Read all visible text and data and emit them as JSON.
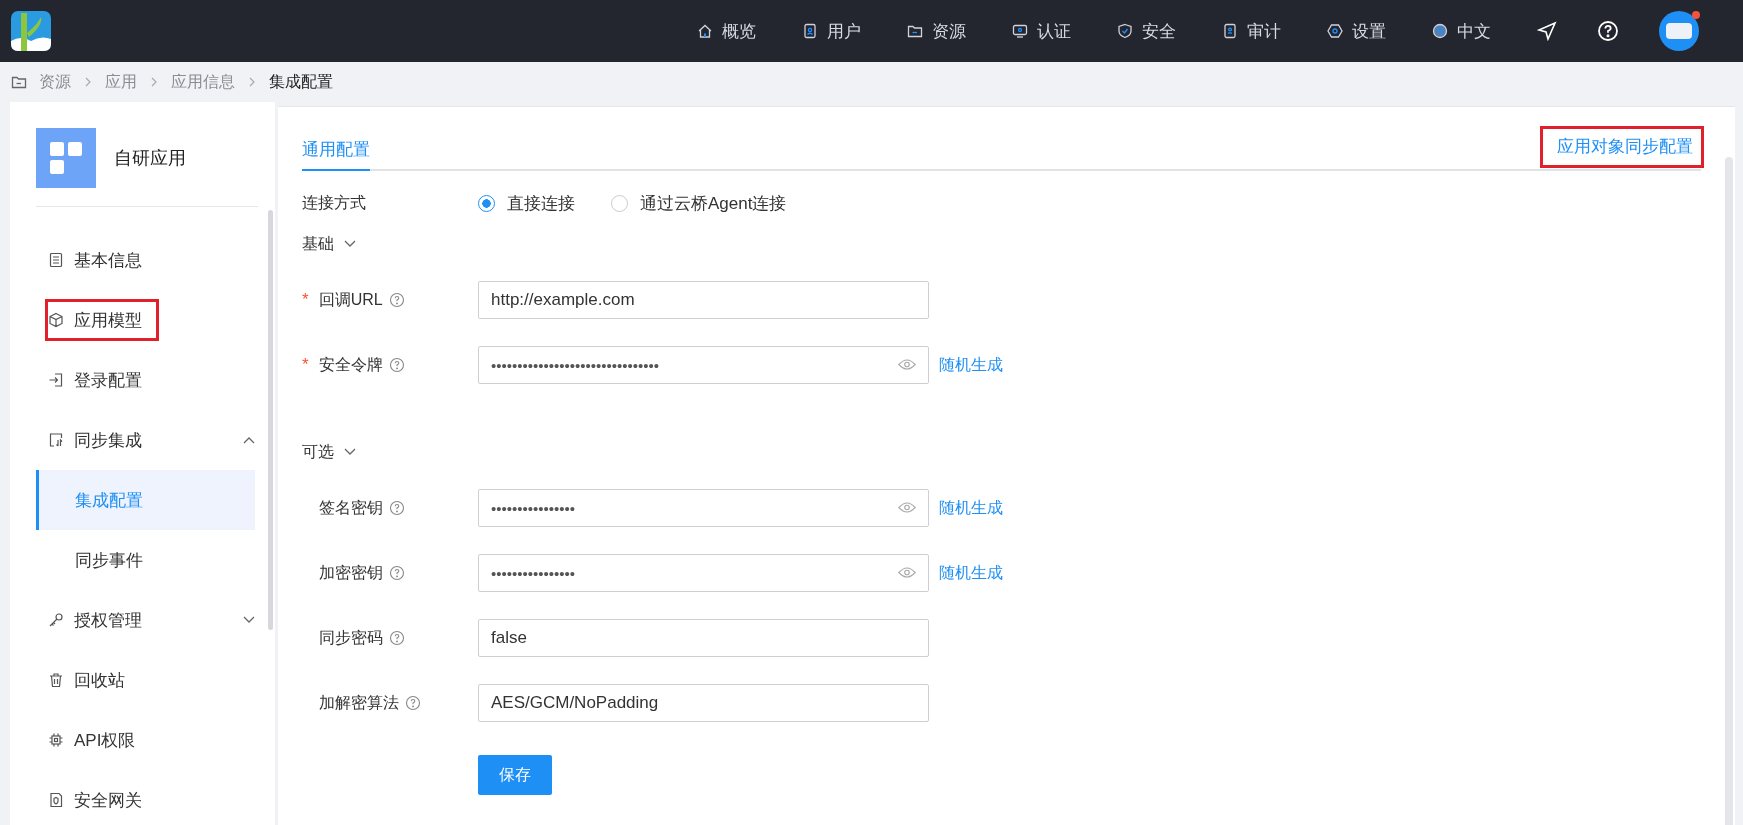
{
  "topbar": {
    "nav": [
      {
        "label": "概览"
      },
      {
        "label": "用户"
      },
      {
        "label": "资源"
      },
      {
        "label": "认证"
      },
      {
        "label": "安全"
      },
      {
        "label": "审计"
      },
      {
        "label": "设置"
      },
      {
        "label": "中文"
      }
    ],
    "avatar": {
      "notification": true
    }
  },
  "breadcrumb": [
    "资源",
    "应用",
    "应用信息",
    "集成配置"
  ],
  "sidebar": {
    "app_name": "自研应用",
    "items": [
      {
        "label": "基本信息",
        "selected": false,
        "highlighted": false
      },
      {
        "label": "应用模型",
        "selected": false,
        "highlighted": true
      },
      {
        "label": "登录配置",
        "selected": false,
        "highlighted": false
      },
      {
        "label": "同步集成",
        "selected": false,
        "highlighted": false,
        "expanded": true,
        "children": [
          {
            "label": "集成配置",
            "selected": true,
            "highlighted": false
          },
          {
            "label": "同步事件",
            "selected": false,
            "highlighted": false
          }
        ]
      },
      {
        "label": "授权管理",
        "selected": false,
        "highlighted": false,
        "expanded": false
      },
      {
        "label": "回收站",
        "selected": false,
        "highlighted": false
      },
      {
        "label": "API权限",
        "selected": false,
        "highlighted": false
      },
      {
        "label": "安全网关",
        "selected": false,
        "highlighted": false
      }
    ]
  },
  "tabs": [
    {
      "label": "通用配置",
      "selected": true
    }
  ],
  "sync_link": {
    "label": "应用对象同步配置",
    "highlighted": true
  },
  "connection": {
    "label": "连接方式",
    "options": [
      {
        "label": "直接连接",
        "selected": true
      },
      {
        "label": "通过云桥Agent连接",
        "selected": false
      }
    ]
  },
  "sections": [
    {
      "title": "基础",
      "expanded": true,
      "indented": false,
      "fields": [
        {
          "label": "回调URL",
          "required": true,
          "kind": "text",
          "value": "http://example.com"
        },
        {
          "label": "安全令牌",
          "required": true,
          "kind": "secret",
          "value": "••••••••••••••••••••••••••••••••",
          "action": "随机生成"
        }
      ]
    },
    {
      "title": "可选",
      "expanded": true,
      "indented": true,
      "fields": [
        {
          "label": "签名密钥",
          "required": false,
          "kind": "secret",
          "value": "••••••••••••••••",
          "action": "随机生成"
        },
        {
          "label": "加密密钥",
          "required": false,
          "kind": "secret",
          "value": "••••••••••••••••",
          "action": "随机生成"
        },
        {
          "label": "同步密码",
          "required": false,
          "kind": "text",
          "value": "false"
        },
        {
          "label": "加解密算法",
          "required": false,
          "kind": "text",
          "value": "AES/GCM/NoPadding"
        }
      ]
    }
  ],
  "required_mark": "*",
  "save_button": "保存"
}
